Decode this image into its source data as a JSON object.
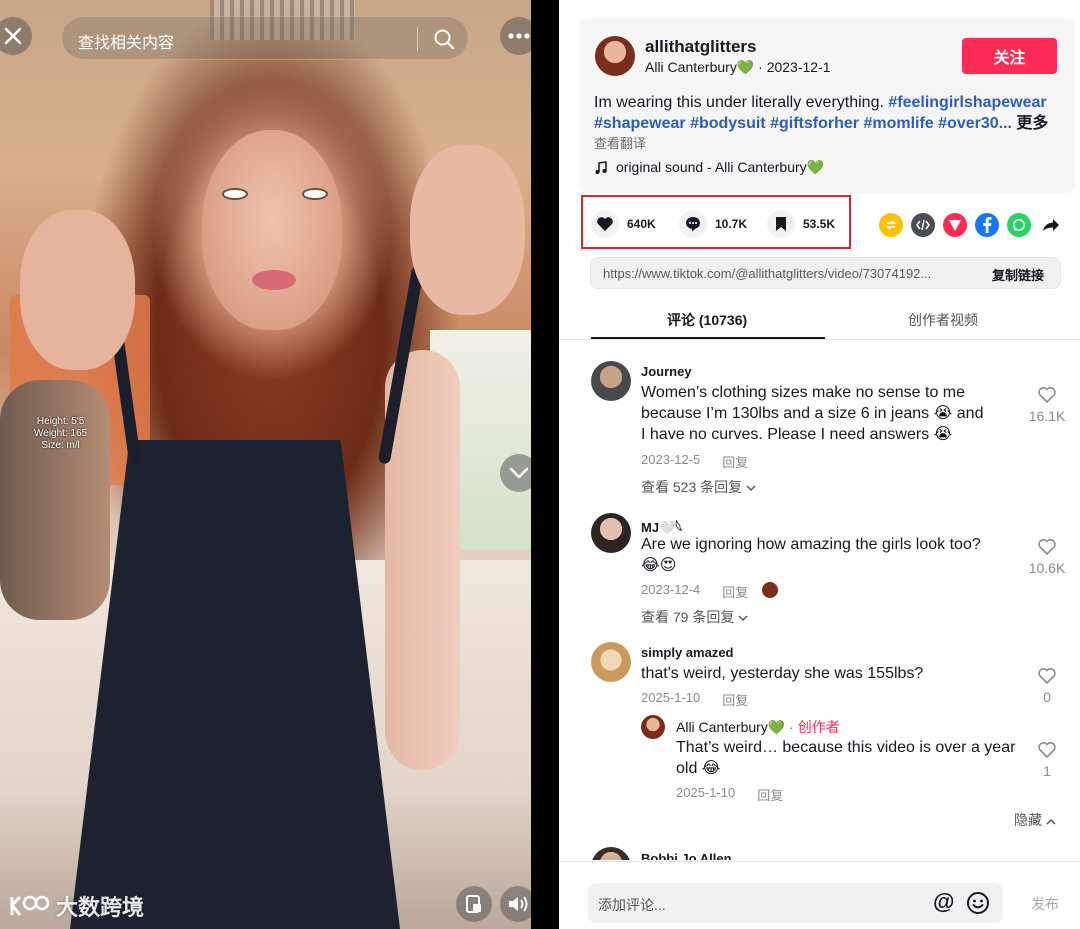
{
  "video": {
    "search_placeholder": "查找相关内容",
    "overlay_lines": [
      "Height: 5'5",
      "Weight: 165",
      "Size: m/l"
    ],
    "watermark": "大数跨境"
  },
  "author": {
    "username": "allithatglitters",
    "display_name": "Alli Canterbury💚",
    "date": "2023-12-1",
    "follow_label": "关注"
  },
  "description": {
    "text": "Im wearing this under literally everything.",
    "tags": [
      "#feelingirlshapewear",
      "#shapewear",
      "#bodysuit",
      "#giftsforher",
      "#momlife",
      "#over30..."
    ],
    "more_label": "更多",
    "translate_label": "查看翻译",
    "sound": "original sound - Alli Canterbury💚"
  },
  "stats": {
    "likes": "640K",
    "comments": "10.7K",
    "saves": "53.5K"
  },
  "share": {
    "url": "https://www.tiktok.com/@allithatglitters/video/73074192...",
    "copy_label": "复制链接"
  },
  "tabs": [
    {
      "label": "评论 (10736)"
    },
    {
      "label": "创作者视频"
    }
  ],
  "comments": [
    {
      "name": "Journey",
      "text": "Women’s clothing sizes make no sense to me because I’m 130lbs and a size 6 in jeans 😭 and I have no curves. Please I need answers 😭",
      "date": "2023-12-5",
      "reply_label": "回复",
      "likes": "16.1K",
      "view_replies": "查看 523 条回复"
    },
    {
      "name": "MJ🤍𓆩",
      "text": "Are we ignoring how amazing the girls look too? 😂😍",
      "date": "2023-12-4",
      "reply_label": "回复",
      "likes": "10.6K",
      "view_replies": "查看 79 条回复"
    },
    {
      "name": "simply amazed",
      "text": "that's weird, yesterday she was 155lbs?",
      "date": "2025-1-10",
      "reply_label": "回复",
      "likes": "0"
    },
    {
      "name": "Bobbi Jo Allen"
    }
  ],
  "reply": {
    "name": "Alli Canterbury💚",
    "creator_label": "· 创作者",
    "text": "That’s weird… because this video is over a year old 😂",
    "date": "2025-1-10",
    "reply_label": "回复",
    "likes": "1",
    "hide_label": "隐藏"
  },
  "composer": {
    "placeholder": "添加评论...",
    "post_label": "发布"
  },
  "colors": {
    "brand_red": "#fe2c55",
    "hashtag_blue": "#2b5db9",
    "highlight_box": "#d9272e"
  }
}
